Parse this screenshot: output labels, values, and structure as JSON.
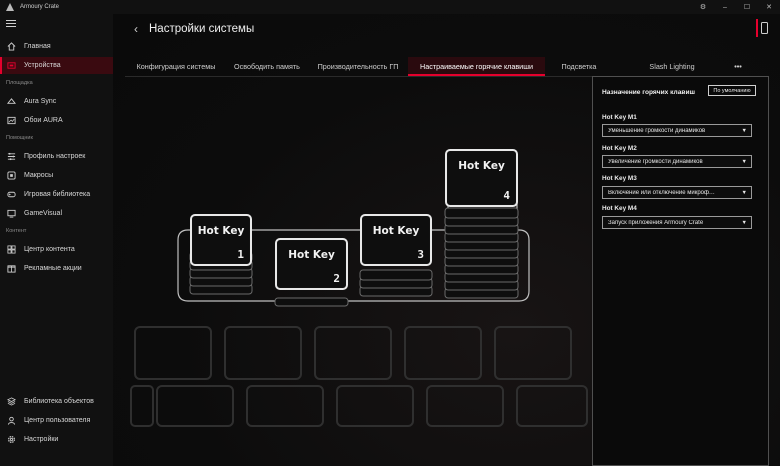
{
  "app": {
    "title": "Armoury Crate"
  },
  "window_controls": {
    "minimize": "–",
    "maximize": "☐",
    "close": "✕",
    "extra": "⚙"
  },
  "sidebar": {
    "top_items": [
      {
        "label": "Главная",
        "icon": "home-icon"
      },
      {
        "label": "Устройства",
        "icon": "devices-icon",
        "active": true
      }
    ],
    "section_platform": "Площадка",
    "platform_items": [
      {
        "label": "Aura Sync",
        "icon": "aura-sync-icon"
      },
      {
        "label": "Обои AURA",
        "icon": "wallpaper-icon"
      }
    ],
    "section_help": "Помощник",
    "help_items": [
      {
        "label": "Профиль настроек",
        "icon": "profile-icon"
      },
      {
        "label": "Макросы",
        "icon": "macro-icon"
      },
      {
        "label": "Игровая библиотека",
        "icon": "game-library-icon"
      },
      {
        "label": "GameVisual",
        "icon": "gamevisual-icon"
      }
    ],
    "section_content": "Контент",
    "content_items": [
      {
        "label": "Центр контента",
        "icon": "content-center-icon"
      },
      {
        "label": "Рекламные акции",
        "icon": "promo-icon"
      }
    ],
    "bottom_items": [
      {
        "label": "Библиотека объектов",
        "icon": "asset-library-icon"
      },
      {
        "label": "Центр пользователя",
        "icon": "user-center-icon"
      },
      {
        "label": "Настройки",
        "icon": "settings-icon"
      }
    ]
  },
  "header": {
    "title": "Настройки системы",
    "back_icon": "back-arrow-icon"
  },
  "tabs": [
    {
      "label": "Конфигурация системы"
    },
    {
      "label": "Освободить память"
    },
    {
      "label": "Производительность ГП"
    },
    {
      "label": "Настраиваемые горячие клавиши",
      "active": true
    },
    {
      "label": "Подсветка"
    },
    {
      "label": "Slash Lighting"
    },
    {
      "label": "•••"
    }
  ],
  "illustration": {
    "keys": [
      {
        "label": "Hot Key",
        "number": "1"
      },
      {
        "label": "Hot Key",
        "number": "2"
      },
      {
        "label": "Hot Key",
        "number": "3"
      },
      {
        "label": "Hot Key",
        "number": "4"
      }
    ]
  },
  "panel": {
    "title": "Назначение горячих клавиш",
    "default_button": "По умолчанию",
    "hotkeys": [
      {
        "name": "Hot Key M1",
        "value": "Уменьшение громкости динамиков"
      },
      {
        "name": "Hot Key M2",
        "value": "Увеличение громкости динамиков"
      },
      {
        "name": "Hot Key M3",
        "value": "Включение или отключение микроф…"
      },
      {
        "name": "Hot Key M4",
        "value": "Запуск приложения Armoury Crate"
      }
    ]
  },
  "colors": {
    "accent": "#e5002d",
    "background": "#0b0b0b",
    "sidebar": "#111111"
  }
}
